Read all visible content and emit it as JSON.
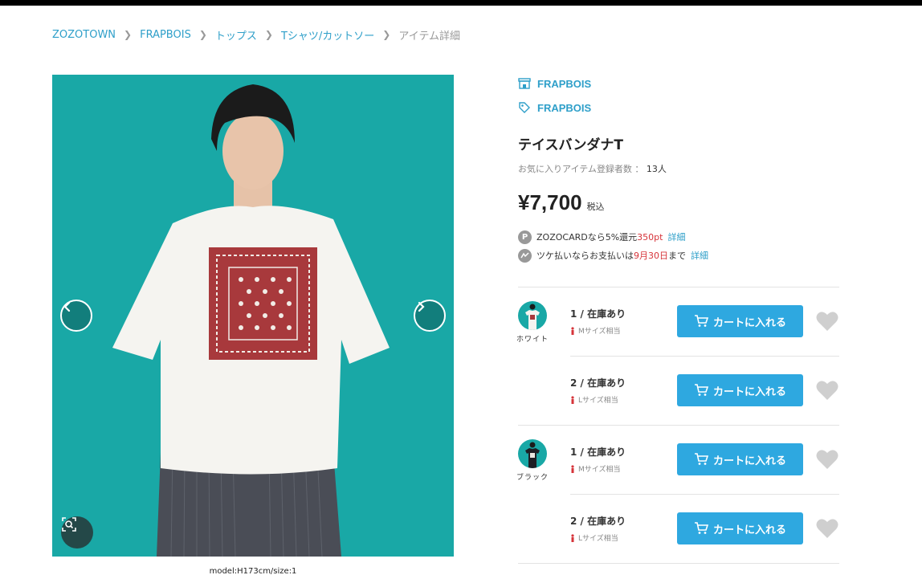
{
  "breadcrumb": {
    "items": [
      "ZOZOTOWN",
      "FRAPBOIS",
      "トップス",
      "Tシャツ/カットソー"
    ],
    "current": "アイテム詳細"
  },
  "image": {
    "caption": "model:H173cm/size:1"
  },
  "shop": {
    "name": "FRAPBOIS",
    "icon": "shop-icon"
  },
  "brand": {
    "name": "FRAPBOIS",
    "icon": "tag-icon"
  },
  "product": {
    "title": "テイスバンダナT",
    "favorites_label": "お気に入りアイテム登録者数 ：",
    "favorites_count": "13人",
    "price": "¥7,700",
    "tax_label": "税込"
  },
  "zozocard": {
    "icon_text": "P",
    "prefix": "ZOZOCARDなら5%還元",
    "points": "350pt",
    "link": "詳細"
  },
  "tsuke": {
    "prefix": "ツケ払いならお支払いは",
    "date": "9月30日",
    "suffix": "まで",
    "link": "詳細"
  },
  "variants": [
    {
      "color": "ホワイト",
      "sizes": [
        {
          "stock": "1 / 在庫あり",
          "size": "Mサイズ相当",
          "button": "カートに入れる"
        },
        {
          "stock": "2 / 在庫あり",
          "size": "Lサイズ相当",
          "button": "カートに入れる"
        }
      ]
    },
    {
      "color": "ブラック",
      "sizes": [
        {
          "stock": "1 / 在庫あり",
          "size": "Mサイズ相当",
          "button": "カートに入れる"
        },
        {
          "stock": "2 / 在庫あり",
          "size": "Lサイズ相当",
          "button": "カートに入れる"
        }
      ]
    }
  ],
  "colors": {
    "accent": "#2ea8e0",
    "link": "#2e9fc9",
    "price_red": "#d6343a",
    "photo_bg": "#19a8a6"
  }
}
